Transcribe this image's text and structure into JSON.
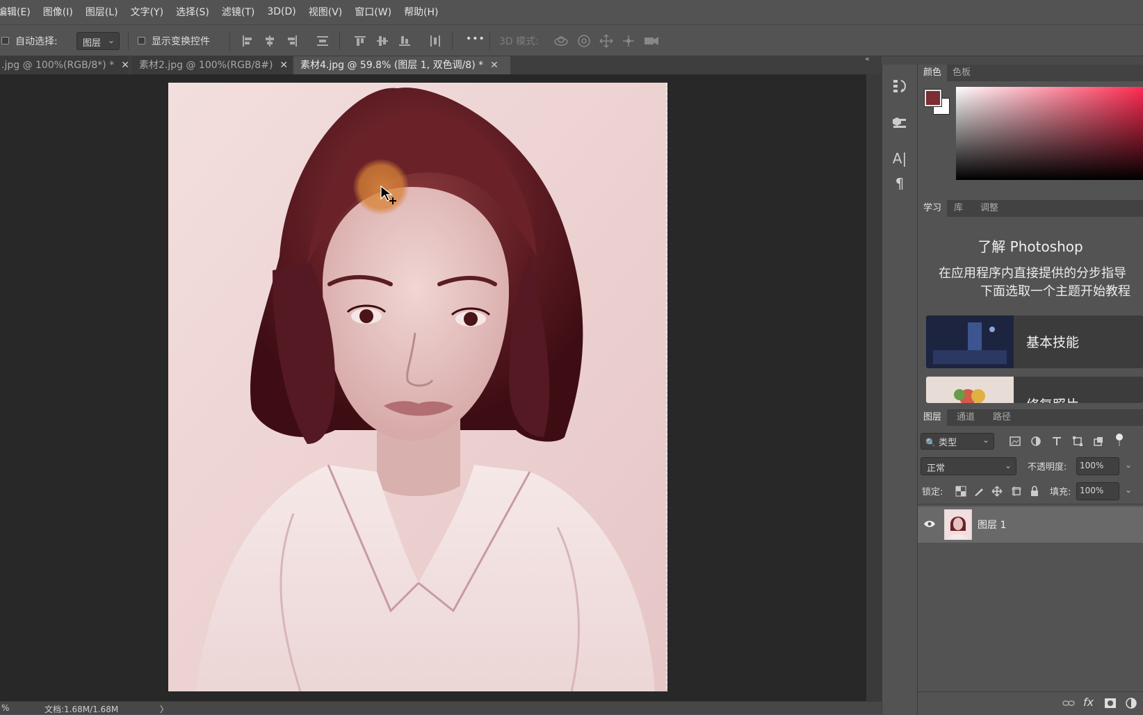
{
  "menu": [
    "编辑(E)",
    "图像(I)",
    "图层(L)",
    "文字(Y)",
    "选择(S)",
    "滤镜(T)",
    "3D(D)",
    "视图(V)",
    "窗口(W)",
    "帮助(H)"
  ],
  "options": {
    "auto_select_label": "自动选择:",
    "auto_select_value": "图层",
    "show_transform_label": "显示变换控件",
    "mode_3d_label": "3D 模式:",
    "more": "•••"
  },
  "tabs": [
    {
      "label": ".jpg @ 100%(RGB/8*) *",
      "close": "✕"
    },
    {
      "label": "素材2.jpg @ 100%(RGB/8#)",
      "close": "✕"
    },
    {
      "label": "素材4.jpg @ 59.8% (图层 1, 双色调/8) *",
      "close": "✕"
    }
  ],
  "status": {
    "zoom": "%",
    "doc": "文档:1.68M/1.68M",
    "arrow": "〉"
  },
  "color_panel": {
    "tabs": [
      "颜色",
      "色板"
    ],
    "foreground": "#7b2f33",
    "background": "#ffffff"
  },
  "learn_panel": {
    "tabs": [
      "学习",
      "库",
      "调整"
    ],
    "title": "了解 Photoshop",
    "line1": "在应用程序内直接提供的分步指导",
    "line2": "下面选取一个主题开始教程",
    "cards": [
      "基本技能",
      "修复照片"
    ]
  },
  "layers_panel": {
    "tabs": [
      "图层",
      "通道",
      "路径"
    ],
    "filter_label": "类型",
    "blend_mode": "正常",
    "opacity_label": "不透明度:",
    "opacity_value": "100%",
    "lock_label": "锁定:",
    "fill_label": "填充:",
    "fill_value": "100%",
    "layer_name": "图层 1",
    "bottom_icons": [
      "link-icon",
      "fx-icon",
      "mask-icon",
      "adjustment-icon"
    ],
    "fx_label": "fx"
  }
}
